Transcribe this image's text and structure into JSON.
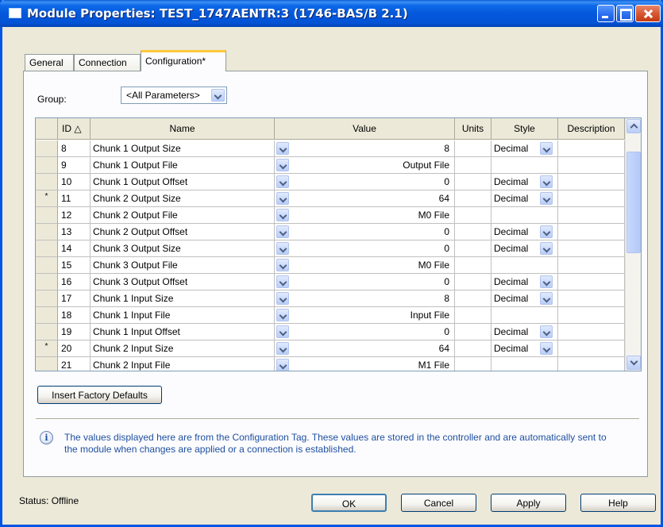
{
  "window": {
    "title": "Module Properties: TEST_1747AENTR:3 (1746-BAS/B 2.1)"
  },
  "tabs": [
    {
      "label": "General"
    },
    {
      "label": "Connection"
    },
    {
      "label": "Configuration*"
    }
  ],
  "group": {
    "label": "Group:",
    "selected": "<All Parameters>"
  },
  "grid": {
    "columns": [
      "",
      "ID △",
      "Name",
      "Value",
      "Units",
      "Style",
      "Description"
    ],
    "rows": [
      {
        "marker": "",
        "id": "8",
        "name": "Chunk 1 Output Size",
        "value": "8",
        "units": "",
        "style": "Decimal",
        "has_style": true
      },
      {
        "marker": "",
        "id": "9",
        "name": "Chunk 1 Output File",
        "value": "Output File",
        "units": "",
        "style": "",
        "has_style": false
      },
      {
        "marker": "",
        "id": "10",
        "name": "Chunk 1 Output Offset",
        "value": "0",
        "units": "",
        "style": "Decimal",
        "has_style": true
      },
      {
        "marker": "*",
        "id": "11",
        "name": "Chunk 2 Output Size",
        "value": "64",
        "units": "",
        "style": "Decimal",
        "has_style": true
      },
      {
        "marker": "",
        "id": "12",
        "name": "Chunk 2 Output File",
        "value": "M0 File",
        "units": "",
        "style": "",
        "has_style": false
      },
      {
        "marker": "",
        "id": "13",
        "name": "Chunk 2 Output Offset",
        "value": "0",
        "units": "",
        "style": "Decimal",
        "has_style": true
      },
      {
        "marker": "",
        "id": "14",
        "name": "Chunk 3 Output Size",
        "value": "0",
        "units": "",
        "style": "Decimal",
        "has_style": true
      },
      {
        "marker": "",
        "id": "15",
        "name": "Chunk 3 Output File",
        "value": "M0 File",
        "units": "",
        "style": "",
        "has_style": false
      },
      {
        "marker": "",
        "id": "16",
        "name": "Chunk 3 Output Offset",
        "value": "0",
        "units": "",
        "style": "Decimal",
        "has_style": true
      },
      {
        "marker": "",
        "id": "17",
        "name": "Chunk 1 Input Size",
        "value": "8",
        "units": "",
        "style": "Decimal",
        "has_style": true
      },
      {
        "marker": "",
        "id": "18",
        "name": "Chunk 1 Input File",
        "value": "Input File",
        "units": "",
        "style": "",
        "has_style": false
      },
      {
        "marker": "",
        "id": "19",
        "name": "Chunk 1 Input Offset",
        "value": "0",
        "units": "",
        "style": "Decimal",
        "has_style": true
      },
      {
        "marker": "*",
        "id": "20",
        "name": "Chunk 2 Input Size",
        "value": "64",
        "units": "",
        "style": "Decimal",
        "has_style": true
      },
      {
        "marker": "",
        "id": "21",
        "name": "Chunk 2 Input File",
        "value": "M1 File",
        "units": "",
        "style": "",
        "has_style": false
      }
    ]
  },
  "buttons": {
    "factory_defaults": "Insert Factory Defaults",
    "ok": "OK",
    "cancel": "Cancel",
    "apply": "Apply",
    "help": "Help"
  },
  "info": {
    "icon": "info-icon",
    "text": "The values displayed here are from the Configuration Tag. These values are stored in the controller and are automatically sent to the module when changes are applied or a connection is established."
  },
  "status": {
    "text": "Status:  Offline"
  },
  "colors": {
    "titlebar": "#0458dc",
    "info_text": "#1f4fa0",
    "active_tab_accent": "#ffc83c"
  }
}
